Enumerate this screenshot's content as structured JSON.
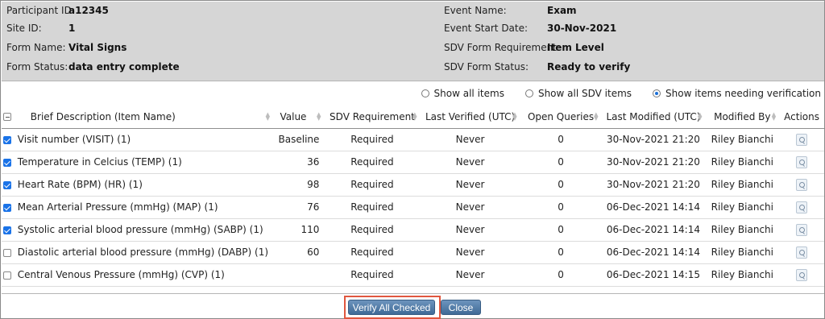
{
  "info": {
    "participant_id_label": "Participant ID:",
    "participant_id": "a12345",
    "site_id_label": "Site ID:",
    "site_id": "1",
    "form_name_label": "Form Name:",
    "form_name": "Vital Signs",
    "form_status_label": "Form Status:",
    "form_status": "data entry complete",
    "event_name_label": "Event Name:",
    "event_name": "Exam",
    "event_start_label": "Event Start Date:",
    "event_start": "30-Nov-2021",
    "sdv_req_label": "SDV Form Requirement:",
    "sdv_req": "Item Level",
    "sdv_status_label": "SDV Form Status:",
    "sdv_status": "Ready to verify"
  },
  "filters": {
    "show_all": "Show all items",
    "show_all_sdv": "Show all SDV items",
    "show_needing": "Show items needing verification",
    "selected": "show_needing"
  },
  "table": {
    "headers": {
      "desc": "Brief Description (Item Name)",
      "value": "Value",
      "sdv_req": "SDV Requirement",
      "last_verified": "Last Verified (UTC)",
      "open_queries": "Open Queries",
      "last_modified": "Last Modified (UTC)",
      "modified_by": "Modified By",
      "actions": "Actions"
    },
    "rows": [
      {
        "checked": true,
        "desc": "Visit number (VISIT) (1)",
        "value": "Baseline",
        "req": "Required",
        "verified": "Never",
        "queries": "0",
        "modified": "30-Nov-2021 21:20",
        "by": "Riley Bianchi"
      },
      {
        "checked": true,
        "desc": "Temperature in Celcius (TEMP) (1)",
        "value": "36",
        "req": "Required",
        "verified": "Never",
        "queries": "0",
        "modified": "30-Nov-2021 21:20",
        "by": "Riley Bianchi"
      },
      {
        "checked": true,
        "desc": "Heart Rate (BPM) (HR) (1)",
        "value": "98",
        "req": "Required",
        "verified": "Never",
        "queries": "0",
        "modified": "30-Nov-2021 21:20",
        "by": "Riley Bianchi"
      },
      {
        "checked": true,
        "desc": "Mean Arterial Pressure (mmHg) (MAP) (1)",
        "value": "76",
        "req": "Required",
        "verified": "Never",
        "queries": "0",
        "modified": "06-Dec-2021 14:14",
        "by": "Riley Bianchi"
      },
      {
        "checked": true,
        "desc": "Systolic arterial blood pressure (mmHg) (SABP) (1)",
        "value": "110",
        "req": "Required",
        "verified": "Never",
        "queries": "0",
        "modified": "06-Dec-2021 14:14",
        "by": "Riley Bianchi"
      },
      {
        "checked": false,
        "desc": "Diastolic arterial blood pressure (mmHg) (DABP) (1)",
        "value": "60",
        "req": "Required",
        "verified": "Never",
        "queries": "0",
        "modified": "06-Dec-2021 14:14",
        "by": "Riley Bianchi"
      },
      {
        "checked": false,
        "desc": "Central Venous Pressure (mmHg) (CVP) (1)",
        "value": "",
        "req": "Required",
        "verified": "Never",
        "queries": "0",
        "modified": "06-Dec-2021 14:15",
        "by": "Riley Bianchi"
      }
    ]
  },
  "footer": {
    "verify_label": "Verify All Checked",
    "close_label": "Close"
  },
  "colors": {
    "panel_bg": "#d6d6d6",
    "accent": "#1a73e8",
    "highlight_border": "#e0573f",
    "button_bg": "#4f78a3"
  }
}
